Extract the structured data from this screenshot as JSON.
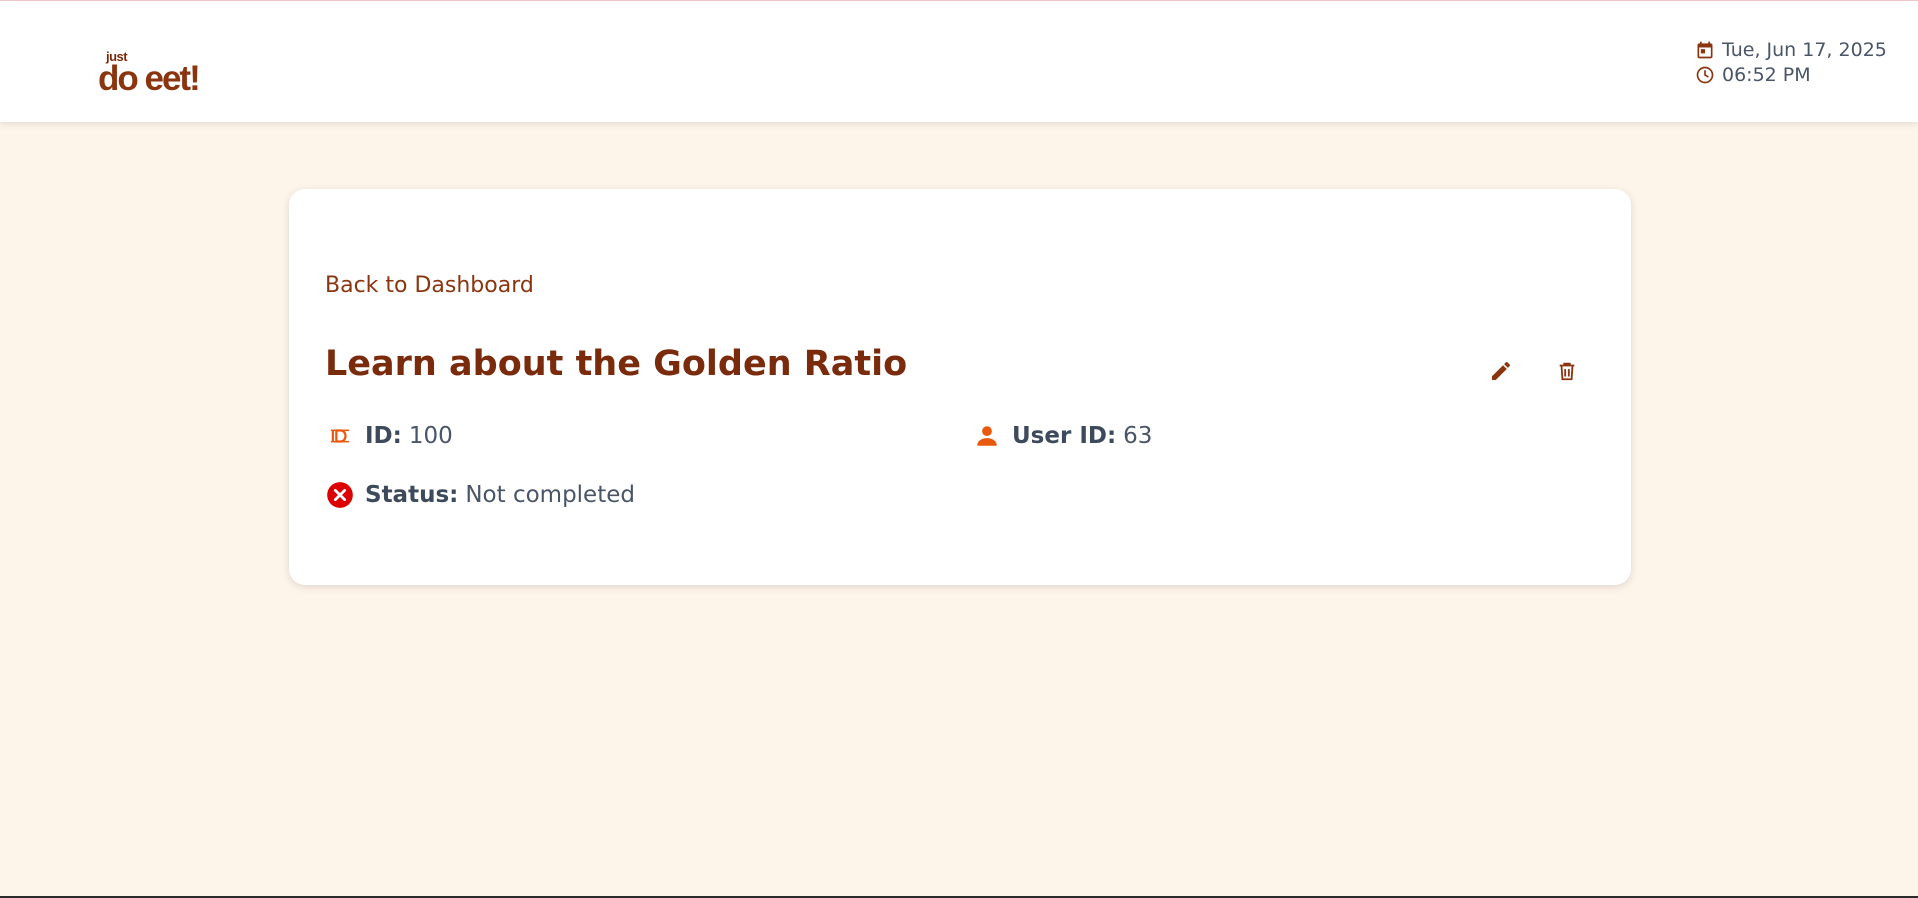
{
  "header": {
    "logo": {
      "small": "just",
      "main": "do eet!"
    },
    "date": "Tue, Jun 17, 2025",
    "time": "06:52 PM",
    "icons": {
      "date": "calendar-icon",
      "time": "clock-icon"
    }
  },
  "todo": {
    "back_label": "Back to Dashboard",
    "title": "Learn about the Golden Ratio",
    "id_label": "ID:",
    "id_value": "100",
    "user_label": "User ID:",
    "user_value": "63",
    "status_label": "Status:",
    "status_value": "Not completed",
    "icons": {
      "id": "id-badge-icon",
      "user": "person-icon",
      "status": "x-circle-icon",
      "edit": "pencil-icon",
      "delete": "trash-icon"
    }
  },
  "colors": {
    "brand": "#8a3510",
    "title": "#7a2b0c",
    "icon_accent": "#ea580c",
    "status_error": "#dc0000",
    "background": "#fdf4ea",
    "text": "#4a5568"
  }
}
